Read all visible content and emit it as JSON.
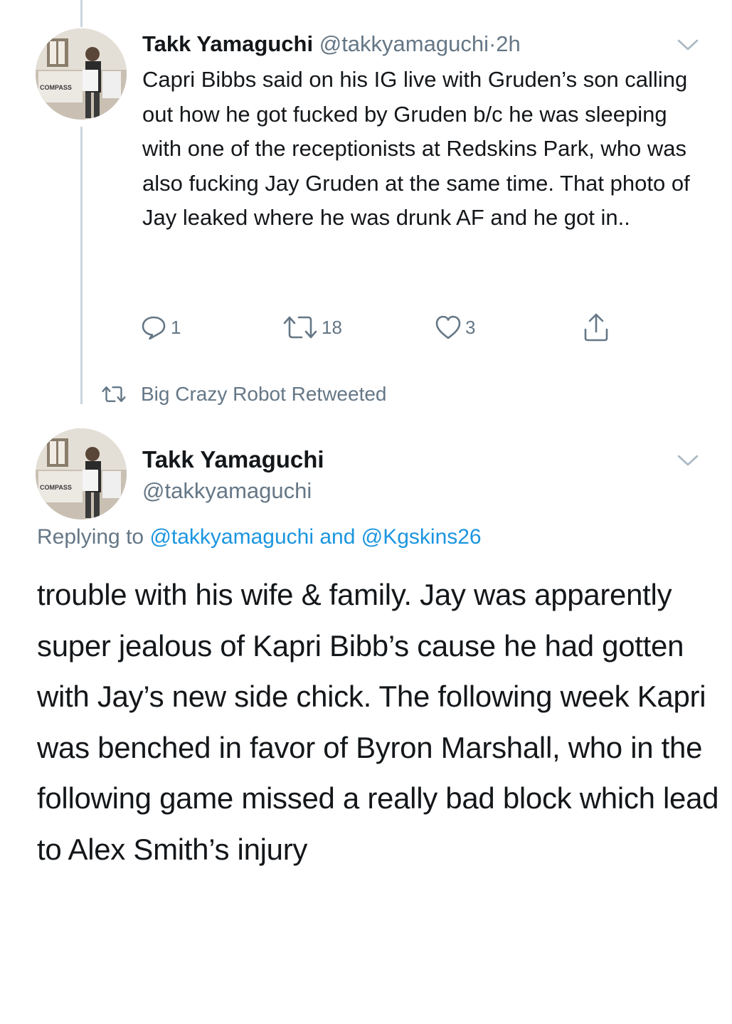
{
  "tweet1": {
    "name": "Takk Yamaguchi",
    "handle": "@takkyamaguchi",
    "separator": "·",
    "time": "2h",
    "text": "Capri Bibbs said on his IG live with Gruden’s son calling out how he got fucked by Gruden b/c he was sleeping with one of the receptionists at Redskins Park, who was also fucking Jay Gruden at the same time.  That photo of Jay leaked where he was drunk AF and he got in..",
    "avatar_label": "COMPASS",
    "replies": "1",
    "retweets": "18",
    "likes": "3"
  },
  "retweet_banner": {
    "text": "Big Crazy Robot Retweeted"
  },
  "tweet2": {
    "name": "Takk Yamaguchi",
    "handle": "@takkyamaguchi",
    "avatar_label": "COMPASS",
    "replying_prefix": "Replying to",
    "replying_to_1": "@takkyamaguchi",
    "replying_and": "and",
    "replying_to_2": "@Kgskins26",
    "text": "trouble with his wife & family.  Jay was apparently super jealous of Kapri Bibb’s cause he had gotten with Jay’s new side chick.  The following week Kapri was benched in favor of Byron Marshall, who in the following game missed a really bad block which lead to Alex Smith’s injury"
  },
  "icons": {
    "reply": "reply-icon",
    "retweet": "retweet-icon",
    "like": "heart-icon",
    "share": "share-icon",
    "more": "chevron-down-icon"
  },
  "colors": {
    "text": "#14171a",
    "secondary": "#657786",
    "link": "#1b95e0",
    "thread_line": "#ccd6dd"
  }
}
